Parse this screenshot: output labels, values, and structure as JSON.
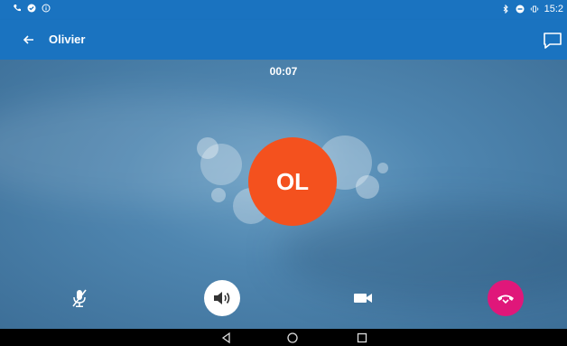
{
  "status_bar": {
    "time": "15:2",
    "left_icons": [
      "phone-icon",
      "check-circle-icon",
      "info-icon"
    ],
    "right_icons": [
      "bluetooth-icon",
      "do-not-disturb-icon",
      "vibrate-icon"
    ]
  },
  "app_bar": {
    "title": "Olivier",
    "back_icon": "arrow-left-icon",
    "chat_icon": "chat-bubble-icon"
  },
  "call": {
    "timer": "00:07",
    "avatar_initials": "OL",
    "avatar_color": "#f4511e"
  },
  "controls": {
    "mute_icon": "mic-muted-icon",
    "speaker_icon": "speaker-icon",
    "video_icon": "video-camera-icon",
    "hangup_icon": "hang-up-icon",
    "hangup_color": "#e0177a"
  },
  "nav_bar": {
    "icons": [
      "back-triangle-icon",
      "home-circle-icon",
      "recents-square-icon"
    ]
  },
  "colors": {
    "accent": "#1a73c0"
  }
}
